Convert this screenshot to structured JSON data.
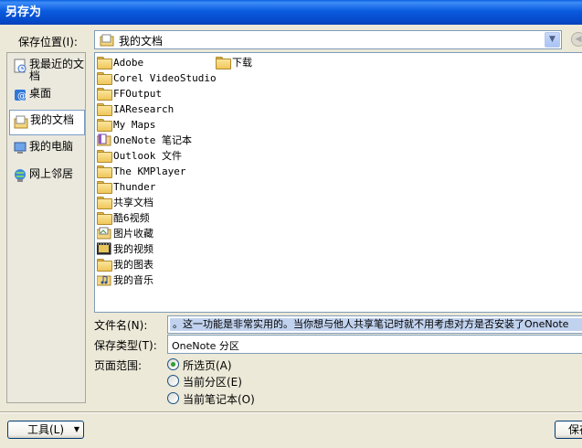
{
  "window": {
    "title": "另存为"
  },
  "save_in": {
    "label": "保存位置(I):",
    "value": "我的文档"
  },
  "places": [
    {
      "label": "我最近的文档",
      "icon": "recent-documents-icon"
    },
    {
      "label": "桌面",
      "icon": "desktop-icon"
    },
    {
      "label": "我的文档",
      "icon": "my-documents-icon"
    },
    {
      "label": "我的电脑",
      "icon": "my-computer-icon"
    },
    {
      "label": "网上邻居",
      "icon": "network-places-icon"
    }
  ],
  "files_col1": [
    {
      "name": "Adobe",
      "icon": "folder-icon"
    },
    {
      "name": "Corel VideoStudio",
      "icon": "folder-icon"
    },
    {
      "name": "FFOutput",
      "icon": "folder-icon"
    },
    {
      "name": "IAResearch",
      "icon": "folder-icon"
    },
    {
      "name": "My Maps",
      "icon": "folder-icon"
    },
    {
      "name": "OneNote 笔记本",
      "icon": "onenote-folder-icon"
    },
    {
      "name": "Outlook 文件",
      "icon": "folder-icon"
    },
    {
      "name": "The KMPlayer",
      "icon": "folder-icon"
    },
    {
      "name": "Thunder",
      "icon": "folder-icon"
    },
    {
      "name": "共享文档",
      "icon": "folder-icon"
    },
    {
      "name": "酷6视频",
      "icon": "folder-icon"
    },
    {
      "name": "图片收藏",
      "icon": "pictures-folder-icon"
    },
    {
      "name": "我的视频",
      "icon": "videos-folder-icon"
    },
    {
      "name": "我的图表",
      "icon": "folder-icon"
    },
    {
      "name": "我的音乐",
      "icon": "music-folder-icon"
    }
  ],
  "files_col2": [
    {
      "name": "下载",
      "icon": "folder-icon"
    }
  ],
  "filename": {
    "label": "文件名(N):",
    "value": "。这一功能是非常实用的。当你想与他人共享笔记时就不用考虑对方是否安装了OneNote"
  },
  "filetype": {
    "label": "保存类型(T):",
    "value": "OneNote 分区"
  },
  "page_range": {
    "label": "页面范围:",
    "options": [
      {
        "label": "所选页(A)",
        "checked": true
      },
      {
        "label": "当前分区(E)",
        "checked": false
      },
      {
        "label": "当前笔记本(O)",
        "checked": false
      }
    ]
  },
  "buttons": {
    "tools": "工具(L)",
    "save": "保存"
  }
}
